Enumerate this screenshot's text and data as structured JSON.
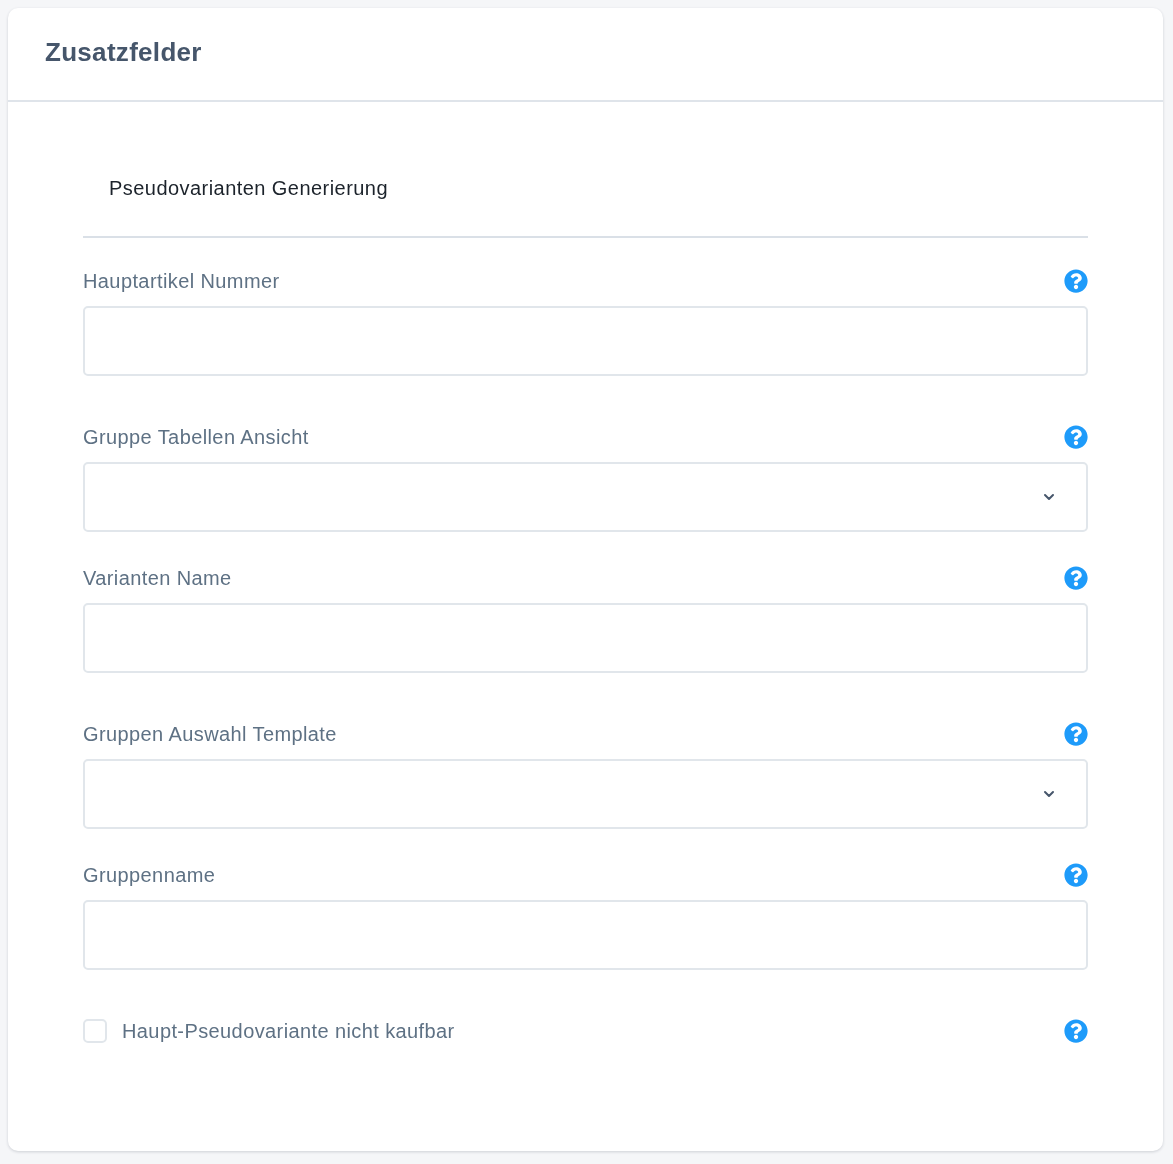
{
  "card": {
    "title": "Zusatzfelder"
  },
  "section": {
    "title": "Pseudovarianten Generierung"
  },
  "fields": [
    {
      "kind": "text",
      "label": "Hauptartikel Nummer"
    },
    {
      "kind": "select",
      "label": "Gruppe Tabellen Ansicht"
    },
    {
      "kind": "text",
      "label": "Varianten Name"
    },
    {
      "kind": "select",
      "label": "Gruppen Auswahl Template"
    },
    {
      "kind": "text",
      "label": "Gruppenname"
    }
  ],
  "checkbox": {
    "label": "Haupt-Pseudovariante nicht kaufbar",
    "checked": false
  }
}
